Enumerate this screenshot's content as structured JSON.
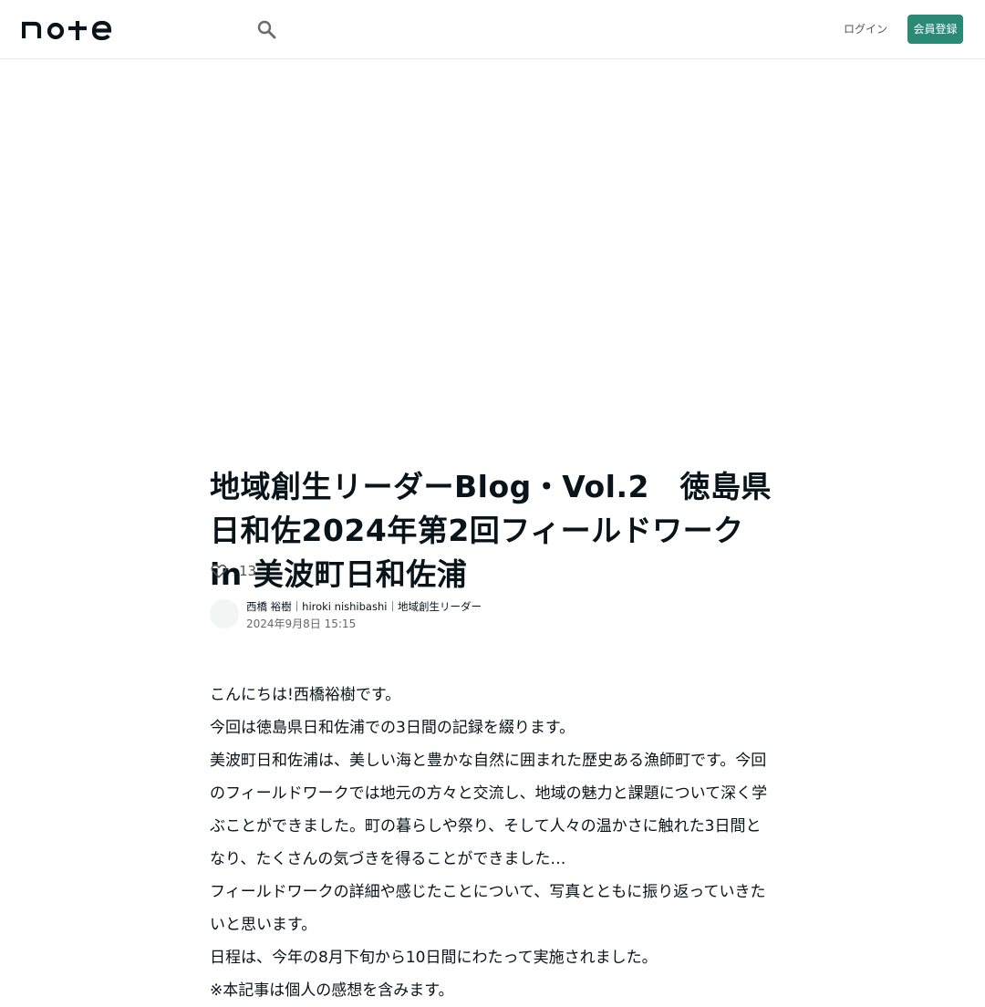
{
  "header": {
    "logo_text": "note",
    "login_label": "ログイン",
    "signup_label": "会員登録"
  },
  "article": {
    "title": "地域創生リーダーBlog・Vol.2　徳島県日和佐2024年第2回フィールドワーク in 美波町日和佐浦",
    "like_count": "13",
    "author_name": "西橋 裕樹｜hiroki nishibashi｜地域創生リーダー",
    "post_date": "2024年9月8日 15:15",
    "paragraphs": [
      "こんにちは!西橋裕樹です。",
      "今回は徳島県日和佐浦での3日間の記録を綴ります。",
      "美波町日和佐浦は、美しい海と豊かな自然に囲まれた歴史ある漁師町です。今回のフィールドワークでは地元の方々と交流し、地域の魅力と課題について深く学ぶことができました。町の暮らしや祭り、そして人々の温かさに触れた3日間となり、たくさんの気づきを得ることができました…",
      "フィールドワークの詳細や感じたことについて、写真とともに振り返っていきたいと思います。",
      "日程は、今年の8月下旬から10日間にわたって実施されました。",
      "※本記事は個人の感想を含みます。"
    ]
  },
  "colors": {
    "accent": "#2b8a75",
    "text": "#08131a",
    "muted": "#555555"
  },
  "icons": {
    "search": "search-icon",
    "like": "heart-outline-icon"
  }
}
